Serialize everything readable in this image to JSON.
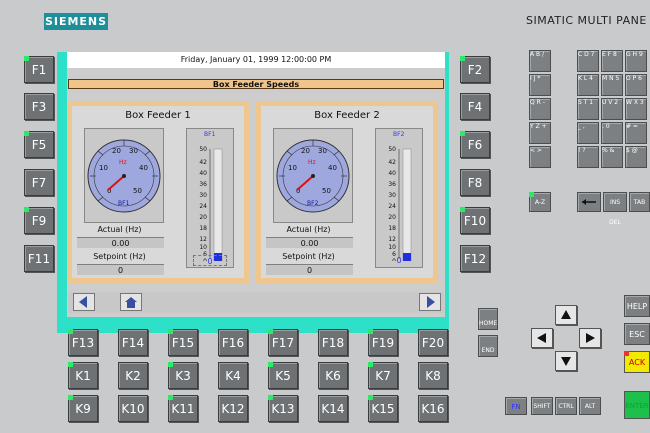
{
  "brand": {
    "logo": "SIEMENS",
    "product": "SIMATIC MULTI PANE"
  },
  "screen": {
    "datetime": "Friday, January 01, 1999 12:00:00 PM",
    "title": "Box Feeder Speeds",
    "feeders": [
      {
        "title": "Box Feeder 1",
        "gauge_tag": "BF1",
        "bar_tag": "BF1",
        "actual_label": "Actual (Hz)",
        "actual_value": "0.00",
        "setpoint_label": "Setpoint (Hz)",
        "setpoint_value": "0",
        "bar_value": "0"
      },
      {
        "title": "Box Feeder 2",
        "gauge_tag": "BF2",
        "bar_tag": "BF2",
        "actual_label": "Actual (Hz)",
        "actual_value": "0.00",
        "setpoint_label": "Setpoint (Hz)",
        "setpoint_value": "0",
        "bar_value": "0"
      }
    ],
    "gauge": {
      "unit": "Hz",
      "ticks": [
        "0",
        "10",
        "20",
        "30",
        "40",
        "50"
      ],
      "value": 0
    },
    "bar_scale": [
      "50",
      "42",
      "40",
      "36",
      "30",
      "24",
      "20",
      "18",
      "12",
      "10",
      "6",
      "0"
    ]
  },
  "left_keys": [
    "F1",
    "F3",
    "F5",
    "F7",
    "F9",
    "F11"
  ],
  "right_keys": [
    "F2",
    "F4",
    "F6",
    "F8",
    "F10",
    "F12"
  ],
  "bottom_row1": [
    "F13",
    "F14",
    "F15",
    "F16",
    "F17",
    "F18",
    "F19",
    "F20"
  ],
  "bottom_row2": [
    "K1",
    "K2",
    "K3",
    "K4",
    "K5",
    "K6",
    "K7",
    "K8"
  ],
  "bottom_row3": [
    "K9",
    "K10",
    "K11",
    "K12",
    "K13",
    "K14",
    "K15",
    "K16"
  ],
  "keypad": [
    [
      "A B /",
      "C D 7",
      "E F 8",
      "G H 9"
    ],
    [
      "I J *",
      "K L 4",
      "M N 5",
      "O P 6"
    ],
    [
      "Q R -",
      "S T 1",
      "U V 2",
      "W X 3"
    ],
    [
      "Y Z +",
      "_ ,",
      ". 0",
      "# ="
    ],
    [
      "< >",
      "! ?",
      "% &",
      "$ @"
    ]
  ],
  "special_keys": {
    "az": "A-Z",
    "ins_del": "INS DEL",
    "tab": "TAB",
    "help": "HELP",
    "esc": "ESC",
    "ack": "ACK",
    "enter": "ENTER",
    "shift": "SHIFT",
    "ctrl": "CTRL",
    "alt": "ALT",
    "fn": "FN",
    "home": "HOME",
    "end": "END"
  },
  "colors": {
    "accent": "#2de0c8",
    "logo": "#1e8f9a",
    "frame": "#efc690",
    "key": "#6f7274",
    "led": "#2ee86a"
  }
}
